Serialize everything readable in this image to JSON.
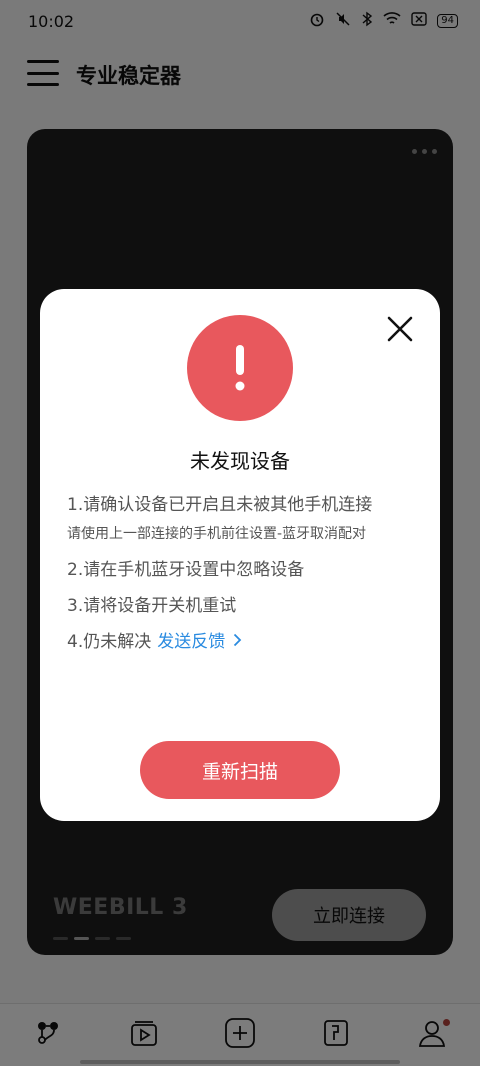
{
  "status_bar": {
    "time": "10:02",
    "battery": "94",
    "icons": [
      "alarm-icon",
      "mute-icon",
      "bluetooth-icon",
      "wifi-icon",
      "close-box-icon",
      "battery-icon"
    ]
  },
  "header": {
    "title": "专业稳定器"
  },
  "device_card": {
    "device_name": "WEEBILL 3",
    "connect_label": "立即连接",
    "pager_count": 4,
    "pager_active": 2
  },
  "dialog": {
    "title": "未发现设备",
    "steps": [
      "1.请确认设备已开启且未被其他手机连接",
      "请使用上一部连接的手机前往设置-蓝牙取消配对",
      "2.请在手机蓝牙设置中忽略设备",
      "3.请将设备开关机重试",
      "4.仍未解决"
    ],
    "feedback_link": "发送反馈",
    "rescan_label": "重新扫描"
  },
  "bottom_nav": {
    "items": [
      "device-icon",
      "media-icon",
      "add-icon",
      "edit-icon",
      "profile-icon"
    ]
  },
  "colors": {
    "accent": "#e8585d",
    "link": "#2a8be0"
  }
}
